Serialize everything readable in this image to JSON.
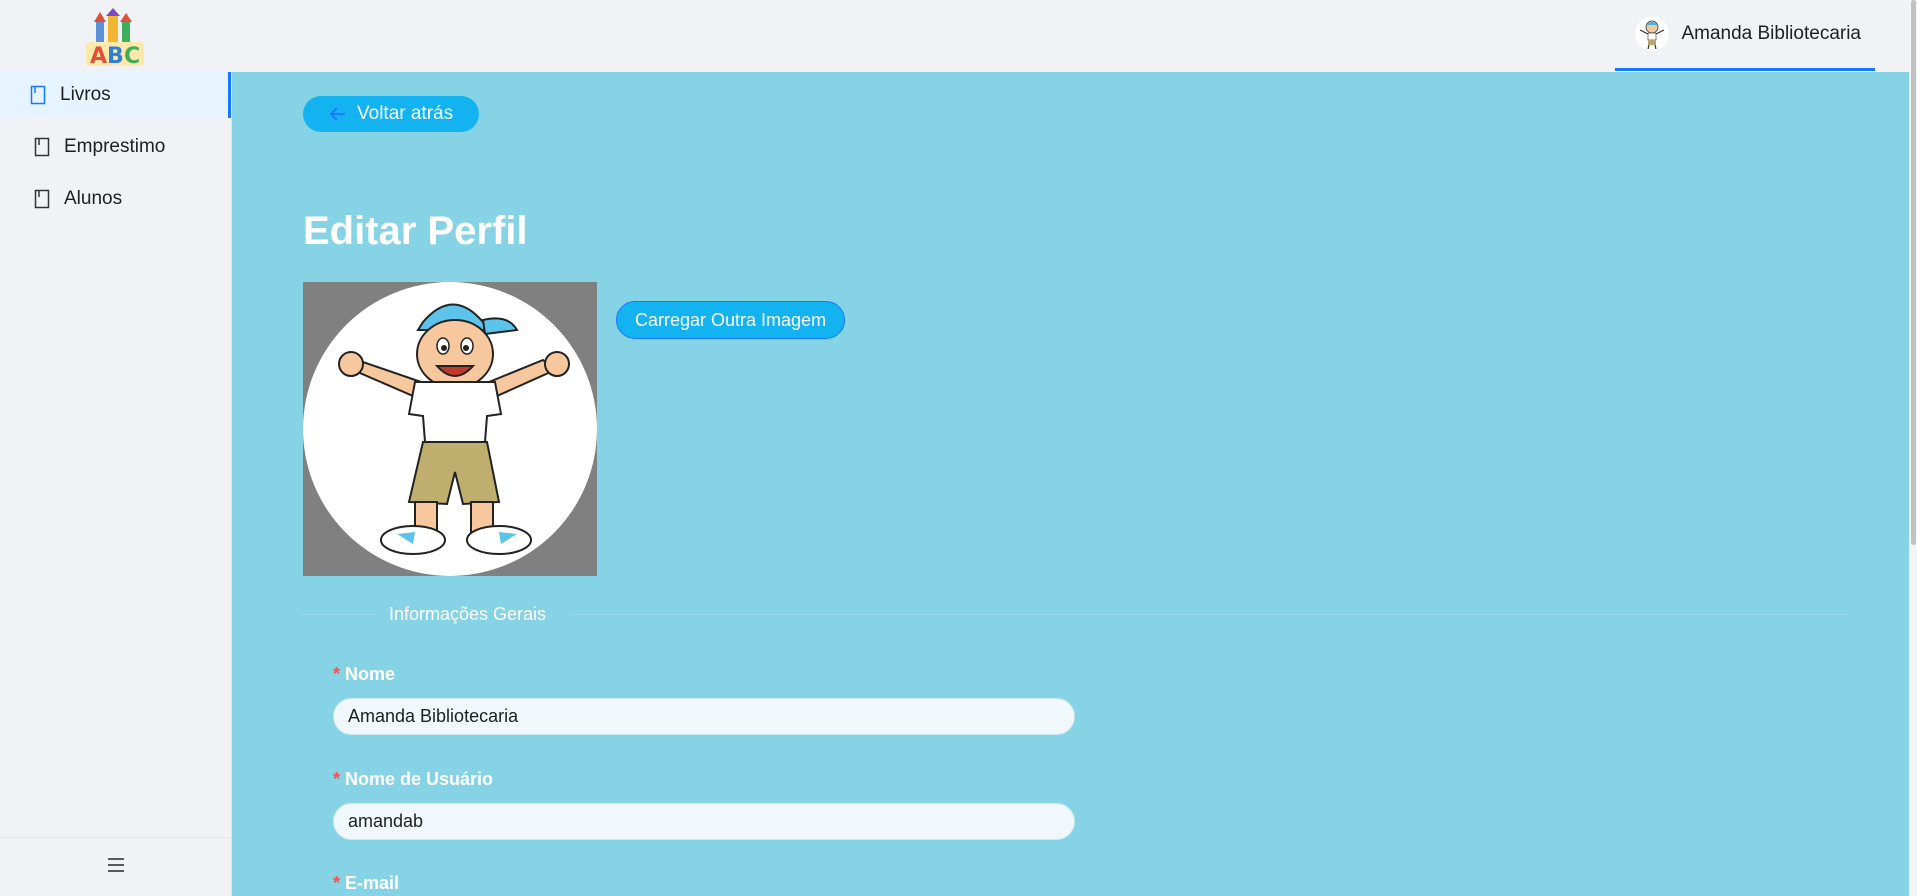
{
  "header": {
    "logo_text": "ABC",
    "user_name": "Amanda Bibliotecaria"
  },
  "sidebar": {
    "items": [
      {
        "label": "Livros",
        "icon": "book-icon",
        "active": true
      },
      {
        "label": "Emprestimo",
        "icon": "book-icon",
        "active": false
      },
      {
        "label": "Alunos",
        "icon": "book-icon",
        "active": false
      }
    ],
    "collapse_icon": "menu-icon"
  },
  "main": {
    "back_label": "Voltar atrás",
    "title": "Editar Perfil",
    "upload_label": "Carregar Outra Imagem",
    "section_label": "Informações Gerais",
    "fields": [
      {
        "label": "Nome",
        "value": "Amanda Bibliotecaria",
        "required": true
      },
      {
        "label": "Nome de Usuário",
        "value": "amandab",
        "required": true
      },
      {
        "label": "E-mail",
        "value": "",
        "required": true
      }
    ]
  },
  "colors": {
    "accent": "#1677ff",
    "button": "#13b3f2",
    "content_bg": "#87d3e6",
    "required": "#ff4d4f"
  }
}
